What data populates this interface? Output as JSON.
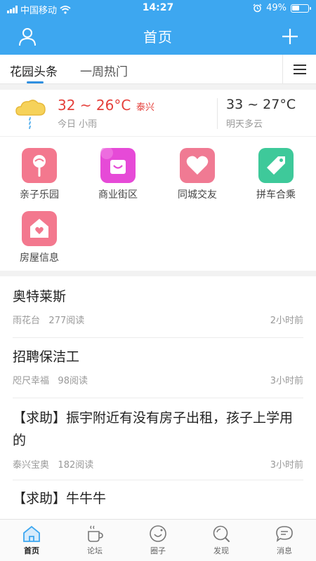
{
  "status_bar": {
    "carrier": "中国移动",
    "time": "14:27",
    "battery": "49%",
    "battery_level": 0.49,
    "icons": [
      "signal-icon",
      "wifi-icon",
      "alarm-icon",
      "battery-icon"
    ]
  },
  "nav": {
    "title": "首页",
    "left_icon": "user-icon",
    "right_icon": "plus-icon"
  },
  "tabs": [
    {
      "label": "花园头条",
      "active": true
    },
    {
      "label": "一周热门",
      "active": false
    }
  ],
  "weather": {
    "icon": "cloud-rain-icon",
    "today_temp": "32 ~ 26°C",
    "city": "泰兴",
    "today_desc": "今日 小雨",
    "tomorrow_temp": "33 ~ 27°C",
    "tomorrow_desc": "明天多云"
  },
  "grid": [
    {
      "label": "亲子乐园",
      "icon": "lollipop-icon",
      "color": "#f3788e"
    },
    {
      "label": "商业街区",
      "icon": "shopping-bag-icon",
      "color": "#e64ad7"
    },
    {
      "label": "同城交友",
      "icon": "heart-icon",
      "color": "#f07a93"
    },
    {
      "label": "拼车合乘",
      "icon": "tag-icon",
      "color": "#3ec99a"
    },
    {
      "label": "房屋信息",
      "icon": "house-heart-icon",
      "color": "#f3788e"
    }
  ],
  "feed": [
    {
      "title": "奥特莱斯",
      "source": "雨花台",
      "reads": "277阅读",
      "time": "2小时前"
    },
    {
      "title": "招聘保洁工",
      "source": "咫尺幸福",
      "reads": "98阅读",
      "time": "3小时前"
    },
    {
      "title": "【求助】振宇附近有没有房子出租，孩子上学用的",
      "source": "泰兴宝奥",
      "reads": "182阅读",
      "time": "3小时前"
    },
    {
      "title": "【求助】牛牛牛",
      "source": "",
      "reads": "",
      "time": ""
    }
  ],
  "bottom_tabs": [
    {
      "label": "首页",
      "icon": "home-icon",
      "active": true
    },
    {
      "label": "论坛",
      "icon": "coffee-cup-icon",
      "active": false
    },
    {
      "label": "圈子",
      "icon": "circle-smile-icon",
      "active": false
    },
    {
      "label": "发现",
      "icon": "search-icon",
      "active": false
    },
    {
      "label": "消息",
      "icon": "chat-bubble-icon",
      "active": false
    }
  ],
  "colors": {
    "nav_bg": "#3da7f0",
    "weather_today": "#e5403b",
    "tab_indicator": "#2f8fe0"
  }
}
